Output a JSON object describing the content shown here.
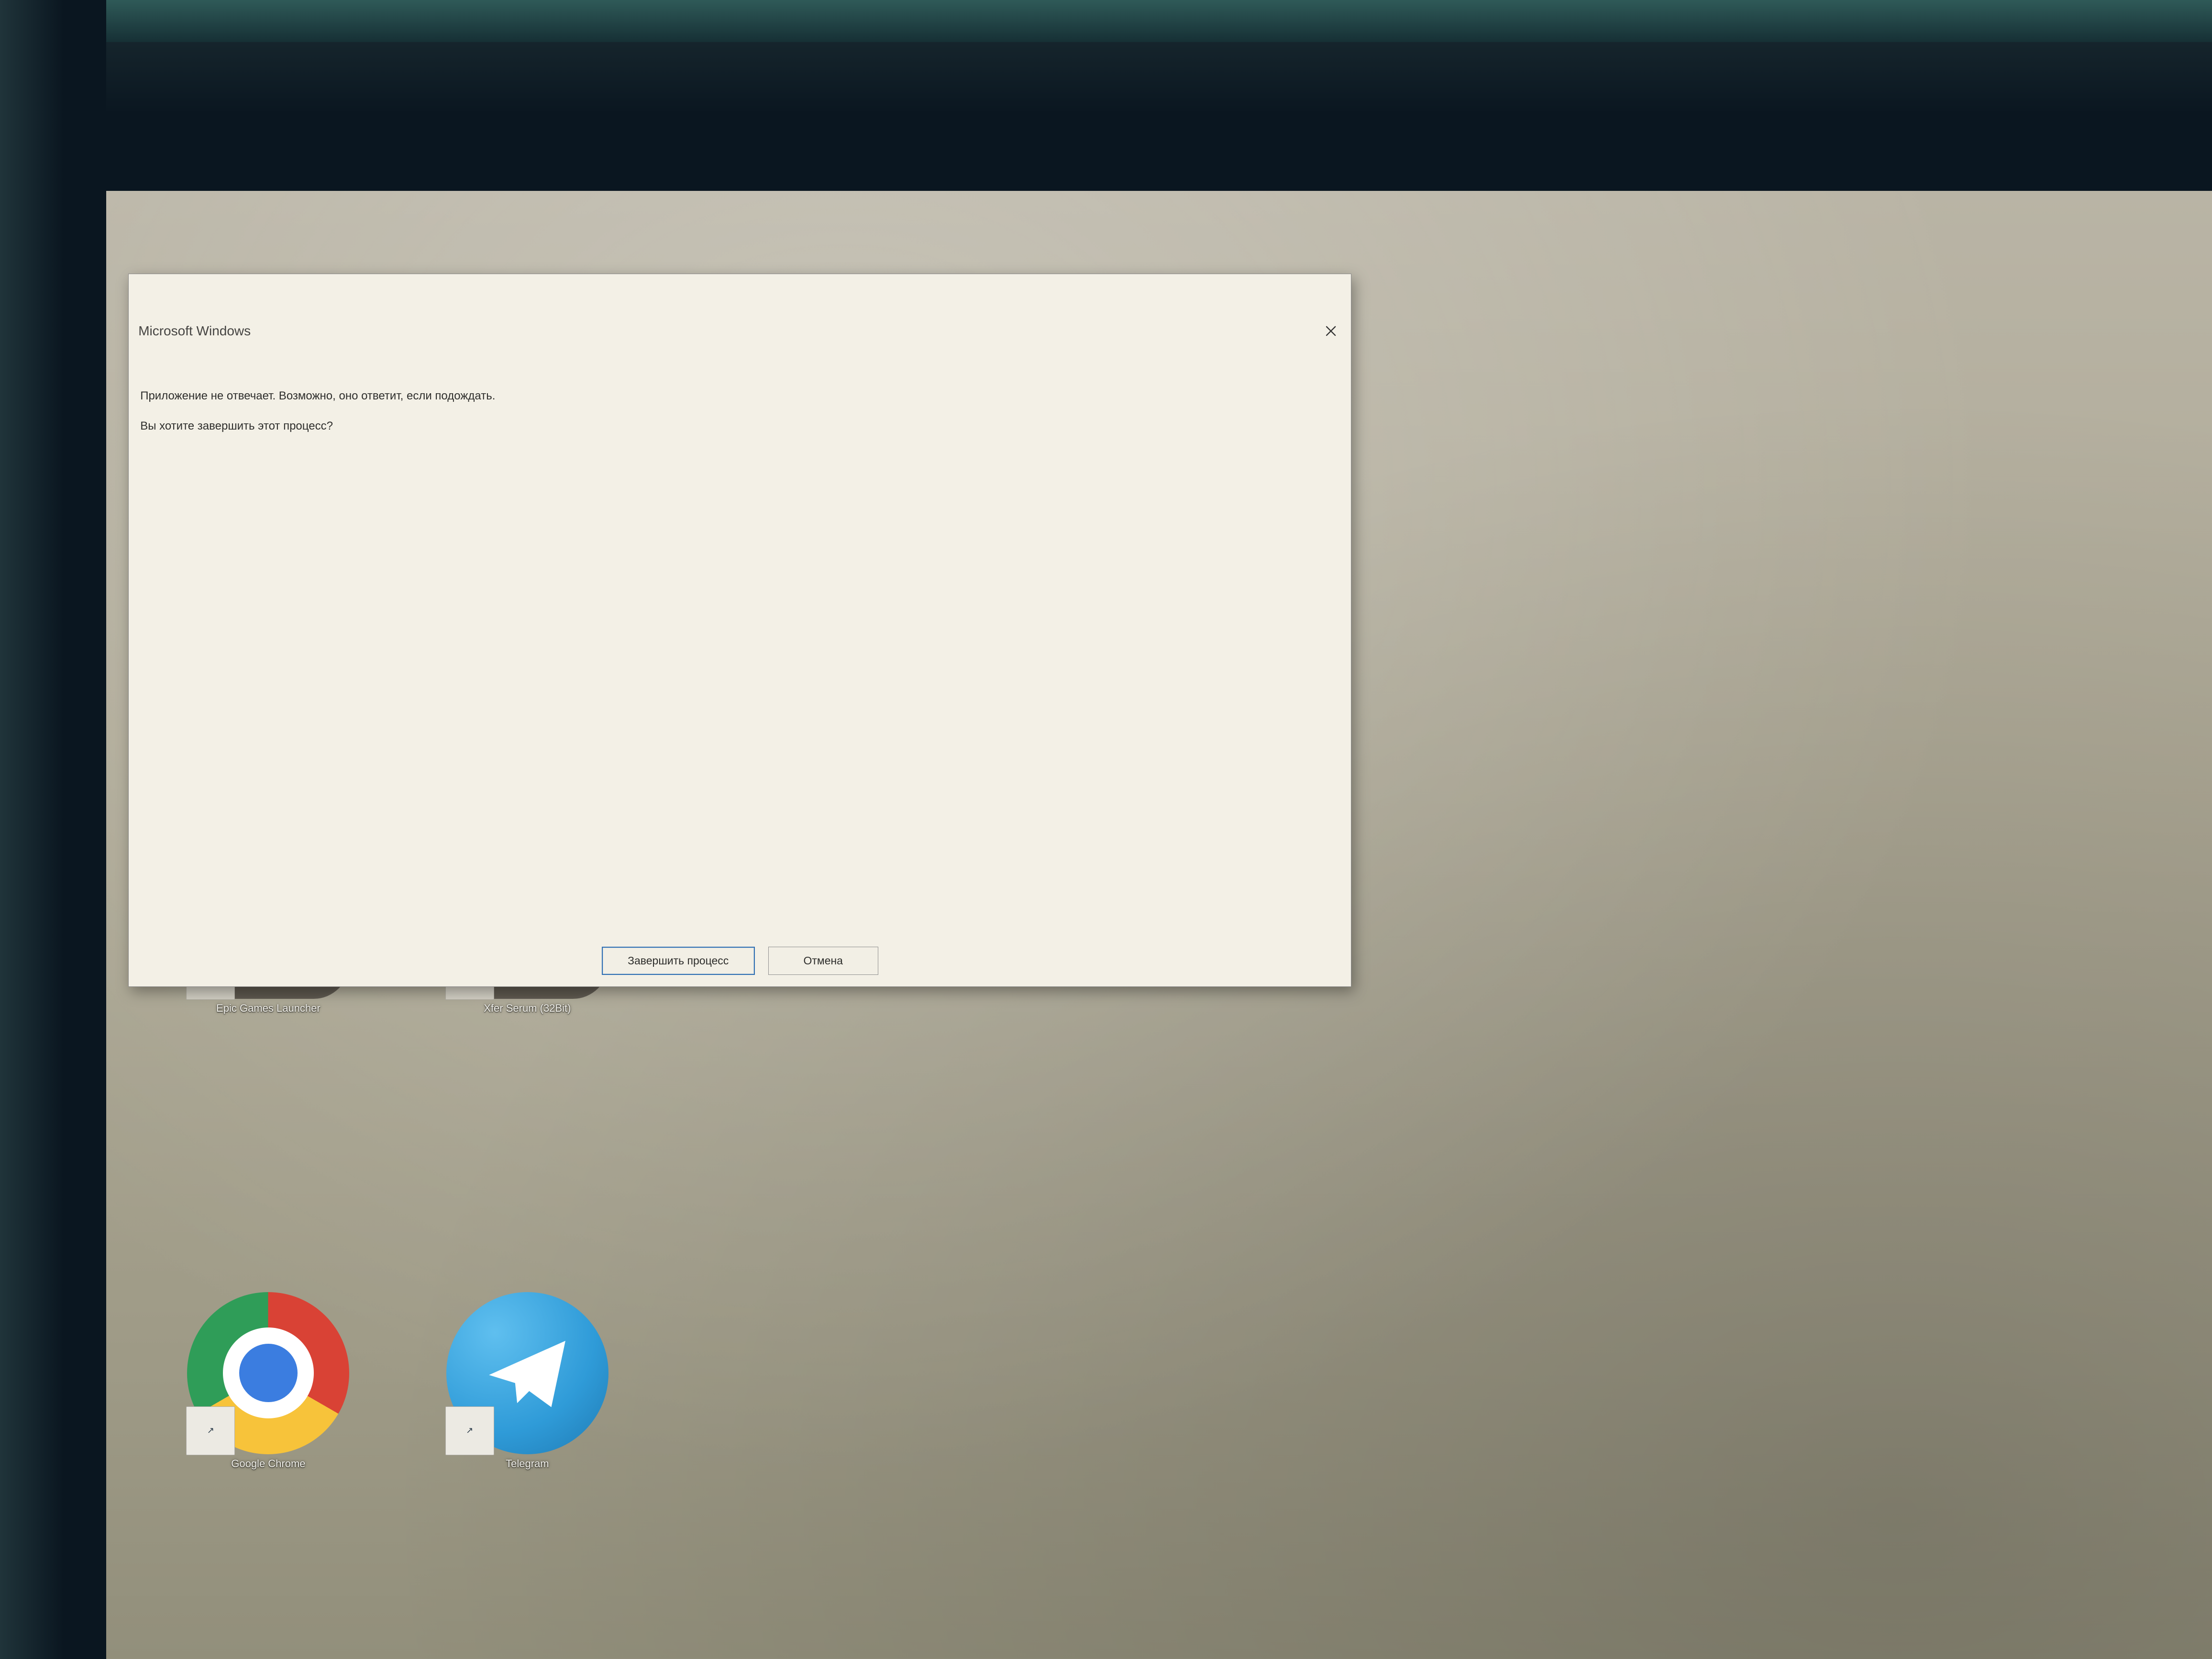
{
  "dialog": {
    "title": "Microsoft Windows",
    "message_line1": "Приложение не отвечает. Возможно, оно ответит, если подождать.",
    "message_line2": "Вы хотите завершить этот процесс?",
    "primary_label": "Завершить процесс",
    "cancel_label": "Отмена"
  },
  "desktop": {
    "shortcuts": {
      "epic": {
        "label": "Epic Games Launcher"
      },
      "serum": {
        "label": "Xfer Serum (32Bit)"
      },
      "chrome": {
        "label": "Google Chrome"
      },
      "telegram": {
        "label": "Telegram"
      }
    }
  }
}
